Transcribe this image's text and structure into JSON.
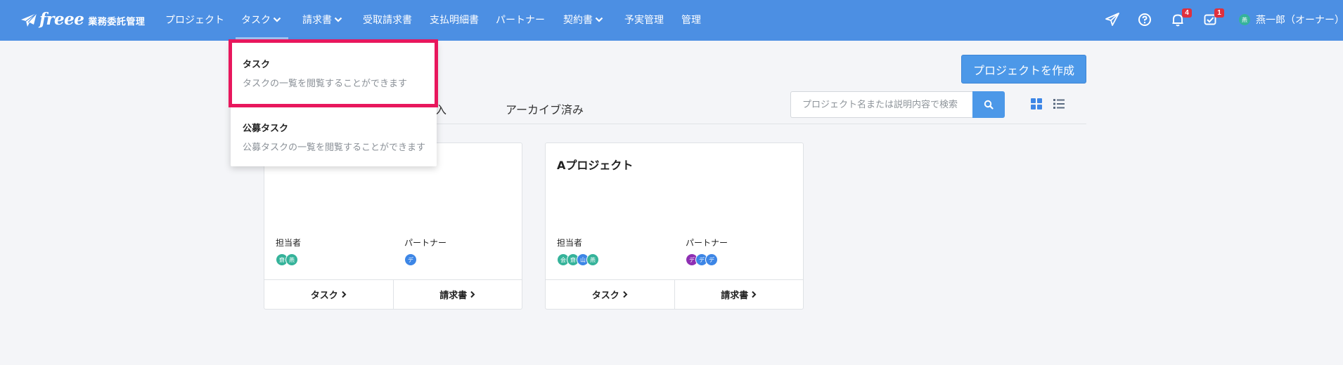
{
  "brand": {
    "logo_text": "freee",
    "product": "業務委託管理"
  },
  "nav": {
    "items": [
      {
        "label": "プロジェクト"
      },
      {
        "label": "タスク"
      },
      {
        "label": "請求書"
      },
      {
        "label": "受取請求書"
      },
      {
        "label": "支払明細書"
      },
      {
        "label": "パートナー"
      },
      {
        "label": "契約書"
      },
      {
        "label": "予実管理"
      },
      {
        "label": "管理"
      }
    ],
    "notification_badge": "4",
    "todo_badge": "1",
    "user": {
      "name": "燕一郎（オーナー）",
      "avatar_text": "燕"
    }
  },
  "dropdown": {
    "items": [
      {
        "title": "タスク",
        "desc": "タスクの一覧を閲覧することができます"
      },
      {
        "title": "公募タスク",
        "desc": "公募タスクの一覧を閲覧することができます"
      }
    ]
  },
  "page": {
    "create_button": "プロジェクトを作成",
    "tabs": [
      "入",
      "アーカイブ済み"
    ],
    "search_placeholder": "プロジェクト名または説明内容で検索"
  },
  "cards": [
    {
      "title": "",
      "assignee_label": "担当者",
      "partner_label": "パートナー",
      "assignees": [
        "齋",
        "燕"
      ],
      "partners": [
        "デ"
      ],
      "task_link": "タスク",
      "invoice_link": "請求書"
    },
    {
      "title": "Aプロジェクト",
      "assignee_label": "担当者",
      "partner_label": "パートナー",
      "assignees": [
        "会",
        "齋",
        "山",
        "燕"
      ],
      "partners": [
        "デ",
        "デ",
        "デ"
      ],
      "task_link": "タスク",
      "invoice_link": "請求書"
    }
  ],
  "colors": {
    "navbar": "#4c8fe3",
    "primary_button": "#4c98e8",
    "badge": "#e0303d",
    "highlight": "#e8175d",
    "avatar_teal": "#35b39a",
    "avatar_blue": "#3d86e6",
    "avatar_purple": "#8e2fb3"
  }
}
